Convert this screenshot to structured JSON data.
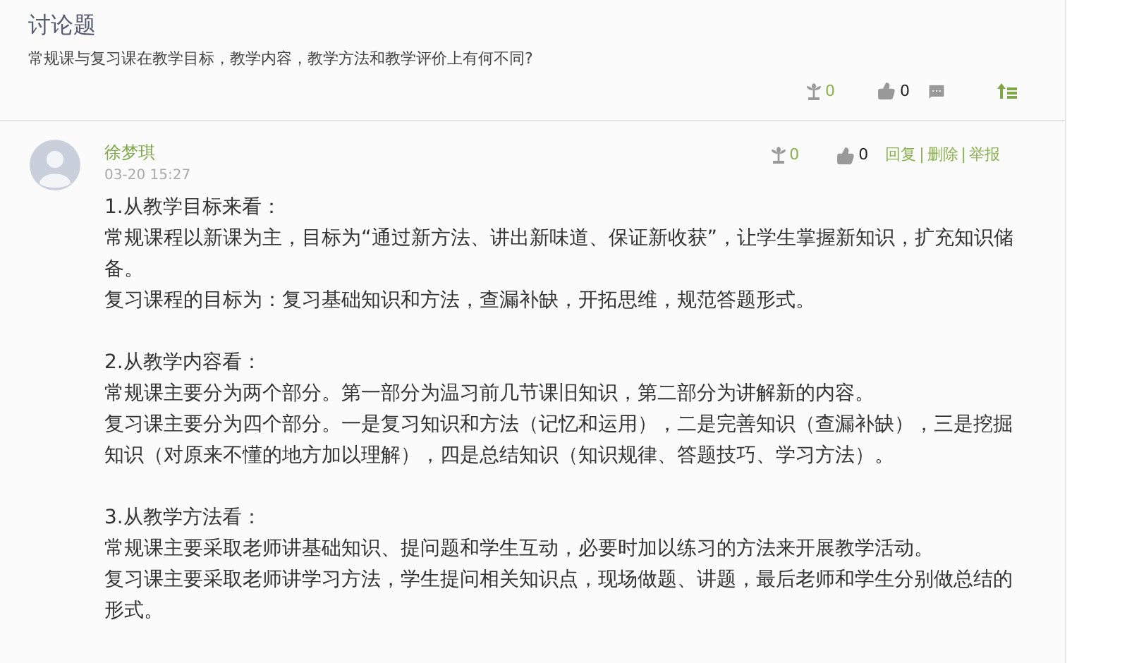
{
  "topic": {
    "title": "讨论题",
    "question": "常规课与复习课在教学目标，教学内容，教学方法和教学评价上有何不同?",
    "flowers": "0",
    "likes": "0"
  },
  "reply": {
    "author": "徐梦琪",
    "time": "03-20 15:27",
    "flowers": "0",
    "likes": "0",
    "separator": "|",
    "actions": [
      "回复",
      "删除",
      "举报"
    ],
    "sections": [
      [
        "1.从教学目标来看：",
        "常规课程以新课为主，目标为“通过新方法、讲出新味道、保证新收获”，让学生掌握新知识，扩充知识储备。",
        "复习课程的目标为：复习基础知识和方法，查漏补缺，开拓思维，规范答题形式。"
      ],
      [
        "2.从教学内容看：",
        "常规课主要分为两个部分。第一部分为温习前几节课旧知识，第二部分为讲解新的内容。",
        "复习课主要分为四个部分。一是复习知识和方法（记忆和运用），二是完善知识（查漏补缺），三是挖掘知识（对原来不懂的地方加以理解），四是总结知识（知识规律、答题技巧、学习方法）。"
      ],
      [
        "3.从教学方法看：",
        "常规课主要采取老师讲基础知识、提问题和学生互动，必要时加以练习的方法来开展教学活动。",
        "复习课主要采取老师讲学习方法，学生提问相关知识点，现场做题、讲题，最后老师和学生分别做总结的形式。"
      ]
    ]
  }
}
